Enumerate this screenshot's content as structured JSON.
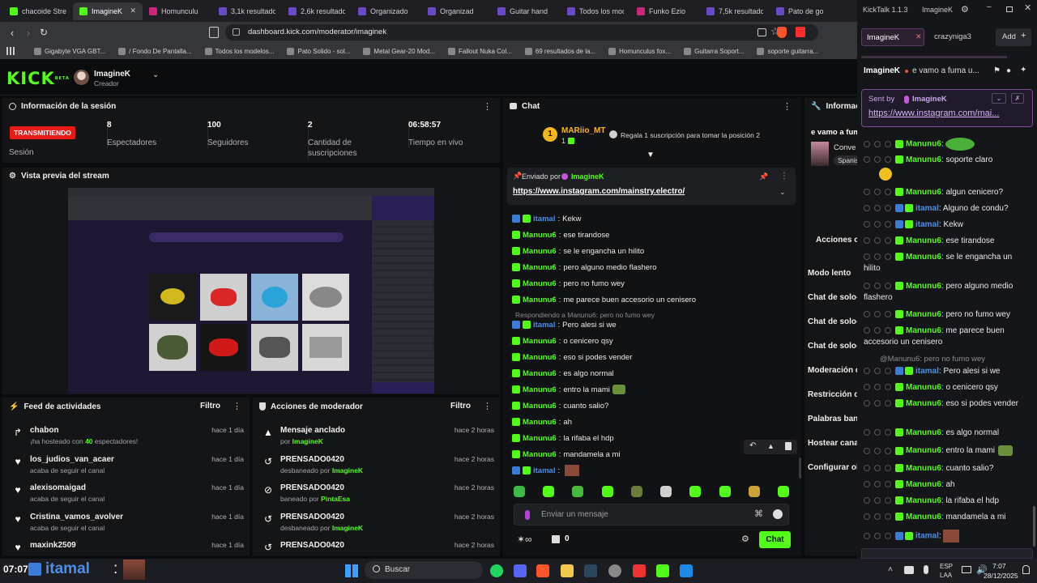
{
  "browser": {
    "tabs": [
      {
        "label": "chacoide Strea",
        "color": "#53fc18"
      },
      {
        "label": "ImagineK",
        "color": "#53fc18",
        "active": true
      },
      {
        "label": "Homunculu",
        "color": "#c7287a"
      },
      {
        "label": "3,1k resultados",
        "color": "#6a4bc7"
      },
      {
        "label": "2,6k resultado",
        "color": "#6a4bc7"
      },
      {
        "label": "Organizado",
        "color": "#6a4bc7"
      },
      {
        "label": "Organizad",
        "color": "#6a4bc7"
      },
      {
        "label": "Guitar hand",
        "color": "#6a4bc7"
      },
      {
        "label": "Todos los mod",
        "color": "#6a4bc7"
      },
      {
        "label": "Funko Ezio",
        "color": "#c7287a"
      },
      {
        "label": "7,5k resultado",
        "color": "#6a4bc7"
      },
      {
        "label": "Pato de go",
        "color": "#6a4bc7"
      }
    ],
    "url": "dashboard.kick.com/moderator/imaginek",
    "bookmarks": [
      "Gigabyte VGA GBT...",
      "/ Fondo De Pantalla...",
      "Todos los modelos...",
      "Pato Solido - sol...",
      "Metal Gear-20 Mod...",
      "Fallout Nuka Col...",
      "69 resultados de la...",
      "Homunculus fox...",
      "Guitarra Soport...",
      "soporte guitarra..."
    ]
  },
  "header": {
    "logo": "KICK",
    "logo_sup": "BETA",
    "channel_name": "ImagineK",
    "channel_role": "Creador"
  },
  "session": {
    "title": "Información de la sesión",
    "status": "TRANSMITIENDO",
    "status_label": "Sesión",
    "stats": [
      {
        "value": "8",
        "label": "Espectadores"
      },
      {
        "value": "100",
        "label": "Seguidores"
      },
      {
        "value": "2",
        "label": "Cantidad de suscripciones"
      },
      {
        "value": "06:58:57",
        "label": "Tiempo en vivo"
      }
    ]
  },
  "preview": {
    "title": "Vista previa del stream"
  },
  "activity": {
    "title": "Feed de actividades",
    "filter": "Filtro",
    "items": [
      {
        "name": "chabon",
        "sub_pre": "¡ha hosteado con ",
        "sub_num": "40",
        "sub_post": " espectadores!",
        "time": "hace 1 día",
        "icon": "host-icon"
      },
      {
        "name": "los_judios_van_acaer",
        "sub": "acaba de seguir el canal",
        "time": "hace 1 día",
        "icon": "heart-icon"
      },
      {
        "name": "alexisomaigad",
        "sub": "acaba de seguir el canal",
        "time": "hace 1 día",
        "icon": "heart-icon"
      },
      {
        "name": "Cristina_vamos_avolver",
        "sub": "acaba de seguir el canal",
        "time": "hace 1 día",
        "icon": "heart-icon"
      },
      {
        "name": "maxink2509",
        "sub": "",
        "time": "hace 1 día",
        "icon": "heart-icon"
      }
    ]
  },
  "modactions": {
    "title": "Acciones de moderador",
    "filter": "Filtro",
    "items": [
      {
        "name": "Mensaje anclado",
        "sub_pre": "por ",
        "sub_user": "ImagineK",
        "time": "hace 2 horas",
        "icon": "pin-icon"
      },
      {
        "name": "PRENSADO0420",
        "sub_pre": "desbaneado por ",
        "sub_user": "ImagineK",
        "time": "hace 2 horas",
        "icon": "unban-icon"
      },
      {
        "name": "PRENSADO0420",
        "sub_pre": "baneado por ",
        "sub_user": "PintaEsa",
        "time": "hace 2 horas",
        "icon": "ban-icon"
      },
      {
        "name": "PRENSADO0420",
        "sub_pre": "desbaneado por ",
        "sub_user": "ImagineK",
        "time": "hace 2 horas",
        "icon": "unban-icon"
      },
      {
        "name": "PRENSADO0420",
        "sub_pre": "",
        "sub_user": "",
        "time": "hace 2 horas",
        "icon": "unban-icon"
      }
    ]
  },
  "chat": {
    "title": "Chat",
    "top_gifter": "MARiio_MT",
    "top_gifter_count": "1",
    "gift_prompt": "Regala 1 suscripción para tomar la posición 2",
    "pinned_by_label": "Enviado por",
    "pinned_by_user": "ImagineK",
    "pinned_link": "https://www.instagram.com/mainstry.electro/",
    "reply_note": "Respondiendo a Manunu6: pero no fumo wey",
    "messages": [
      {
        "user": "itamal",
        "text": "Kekw"
      },
      {
        "user": "Manunu6",
        "text": "ese tirandose"
      },
      {
        "user": "Manunu6",
        "text": "se le engancha un hilito"
      },
      {
        "user": "Manunu6",
        "text": "pero alguno medio flashero"
      },
      {
        "user": "Manunu6",
        "text": "pero no fumo wey"
      },
      {
        "user": "Manunu6",
        "text": "me parece buen accesorio un cenisero"
      },
      {
        "user": "itamal",
        "text": "Pero alesi si we"
      },
      {
        "user": "Manunu6",
        "text": "o cenicero qsy"
      },
      {
        "user": "Manunu6",
        "text": "eso si podes vender"
      },
      {
        "user": "Manunu6",
        "text": "es algo normal"
      },
      {
        "user": "Manunu6",
        "text": "entro la mami"
      },
      {
        "user": "Manunu6",
        "text": "cuanto salio?"
      },
      {
        "user": "Manunu6",
        "text": "ah"
      },
      {
        "user": "Manunu6",
        "text": "la rifaba el hdp"
      },
      {
        "user": "Manunu6",
        "text": "mandamela a mi"
      },
      {
        "user": "itamal",
        "text": ""
      }
    ],
    "input_placeholder": "Enviar un mensaje",
    "points": "0",
    "send_label": "Chat"
  },
  "info_right": {
    "title": "Informació",
    "stream_title": "e vamo a fum",
    "category": "Conve",
    "tag": "Spanis",
    "mod_actions_title": "Acciones c",
    "settings": [
      "Modo lento",
      "Chat de solo-",
      "Chat de solo-",
      "Chat de solo-",
      "Moderación d",
      "Restricción de",
      "Palabras banc",
      "Hostear canal",
      "Configurar ob"
    ]
  },
  "kicktalk": {
    "app": "KickTalk 1.1.3",
    "window_user": "ImagineK",
    "tabs": [
      "ImagineK",
      "crazyniga3"
    ],
    "add_label": "Add",
    "stream_user": "ImagineK",
    "stream_title": "e vamo a fuma u...",
    "sent_by_label": "Sent by",
    "sent_by_user": "ImagineK",
    "pinned_link": "https://www.instagram.com/mai...",
    "reply_note": "@Manunu6: pero no fumo wey",
    "messages": [
      {
        "user": "Manunu6",
        "text": ""
      },
      {
        "user": "Manunu6",
        "text": "soporte claro"
      },
      {
        "user": "Manunu6",
        "text": "algun cenicero?"
      },
      {
        "user": "itamal",
        "text": "Alguno de condu?"
      },
      {
        "user": "itamal",
        "text": "Kekw"
      },
      {
        "user": "Manunu6",
        "text": "ese tirandose"
      },
      {
        "user": "Manunu6",
        "text": "se le engancha un hilito"
      },
      {
        "user": "Manunu6",
        "text": "pero alguno medio flashero"
      },
      {
        "user": "Manunu6",
        "text": "pero no fumo wey"
      },
      {
        "user": "Manunu6",
        "text": "me parece buen accesorio un cenisero"
      },
      {
        "user": "itamal",
        "text": "Pero alesi si we"
      },
      {
        "user": "Manunu6",
        "text": "o cenicero qsy"
      },
      {
        "user": "Manunu6",
        "text": "eso si podes vender"
      },
      {
        "user": "Manunu6",
        "text": "es algo normal"
      },
      {
        "user": "Manunu6",
        "text": "entro la mami"
      },
      {
        "user": "Manunu6",
        "text": "cuanto salio?"
      },
      {
        "user": "Manunu6",
        "text": "ah"
      },
      {
        "user": "Manunu6",
        "text": "la rifaba el hdp"
      },
      {
        "user": "Manunu6",
        "text": "mandamela a mi"
      },
      {
        "user": "itamal",
        "text": ""
      }
    ]
  },
  "taskbar": {
    "overlay_time": "07:07",
    "overlay_user": "itamal",
    "search": "Buscar",
    "lang_top": "ESP",
    "lang_bottom": "LAA",
    "time": "7:07",
    "date": "28/12/2025"
  }
}
